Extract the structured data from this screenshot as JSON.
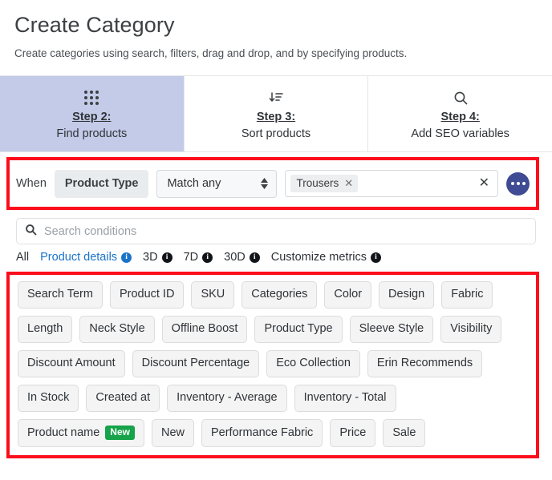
{
  "header": {
    "title": "Create Category",
    "subtitle": "Create categories using search, filters, drag and drop, and by specifying products."
  },
  "steps": [
    {
      "label": "Step 2:",
      "desc": "Find products",
      "icon": "grid-dots-icon",
      "active": true
    },
    {
      "label": "Step 3:",
      "desc": "Sort products",
      "icon": "sort-descending-icon",
      "active": false
    },
    {
      "label": "Step 4:",
      "desc": "Add SEO variables",
      "icon": "search-icon",
      "active": false
    }
  ],
  "condition": {
    "when_label": "When",
    "field": "Product Type",
    "match_mode": "Match any",
    "tokens": [
      "Trousers"
    ],
    "token_remove_glyph": "✕",
    "clear_glyph": "✕",
    "more_button": "more-options-button"
  },
  "search": {
    "placeholder": "Search conditions",
    "value": ""
  },
  "metrics": [
    {
      "label": "All",
      "info": false,
      "active": false
    },
    {
      "label": "Product details",
      "info": true,
      "active": true
    },
    {
      "label": "3D",
      "info": true,
      "active": false
    },
    {
      "label": "7D",
      "info": true,
      "active": false
    },
    {
      "label": "30D",
      "info": true,
      "active": false
    },
    {
      "label": "Customize metrics",
      "info": true,
      "active": false
    }
  ],
  "chip_rows": [
    [
      {
        "label": "Search Term"
      },
      {
        "label": "Product ID"
      },
      {
        "label": "SKU"
      },
      {
        "label": "Categories"
      },
      {
        "label": "Color"
      },
      {
        "label": "Design"
      },
      {
        "label": "Fabric"
      }
    ],
    [
      {
        "label": "Length"
      },
      {
        "label": "Neck Style"
      },
      {
        "label": "Offline Boost"
      },
      {
        "label": "Product Type"
      },
      {
        "label": "Sleeve Style"
      },
      {
        "label": "Visibility"
      }
    ],
    [
      {
        "label": "Discount Amount"
      },
      {
        "label": "Discount Percentage"
      },
      {
        "label": "Eco Collection"
      },
      {
        "label": "Erin Recommends"
      }
    ],
    [
      {
        "label": "In Stock"
      },
      {
        "label": "Created at"
      },
      {
        "label": "Inventory - Average"
      },
      {
        "label": "Inventory - Total"
      }
    ],
    [
      {
        "label": "Product name",
        "badge": "New"
      },
      {
        "label": "New"
      },
      {
        "label": "Performance Fabric"
      },
      {
        "label": "Price"
      },
      {
        "label": "Sale"
      }
    ]
  ],
  "colors": {
    "active_step_bg": "#c3cbe8",
    "annotation_red": "#fc0d1b",
    "accent_blue": "#1a73c8",
    "more_button_indigo": "#3f4c93",
    "badge_green": "#16a34a"
  }
}
